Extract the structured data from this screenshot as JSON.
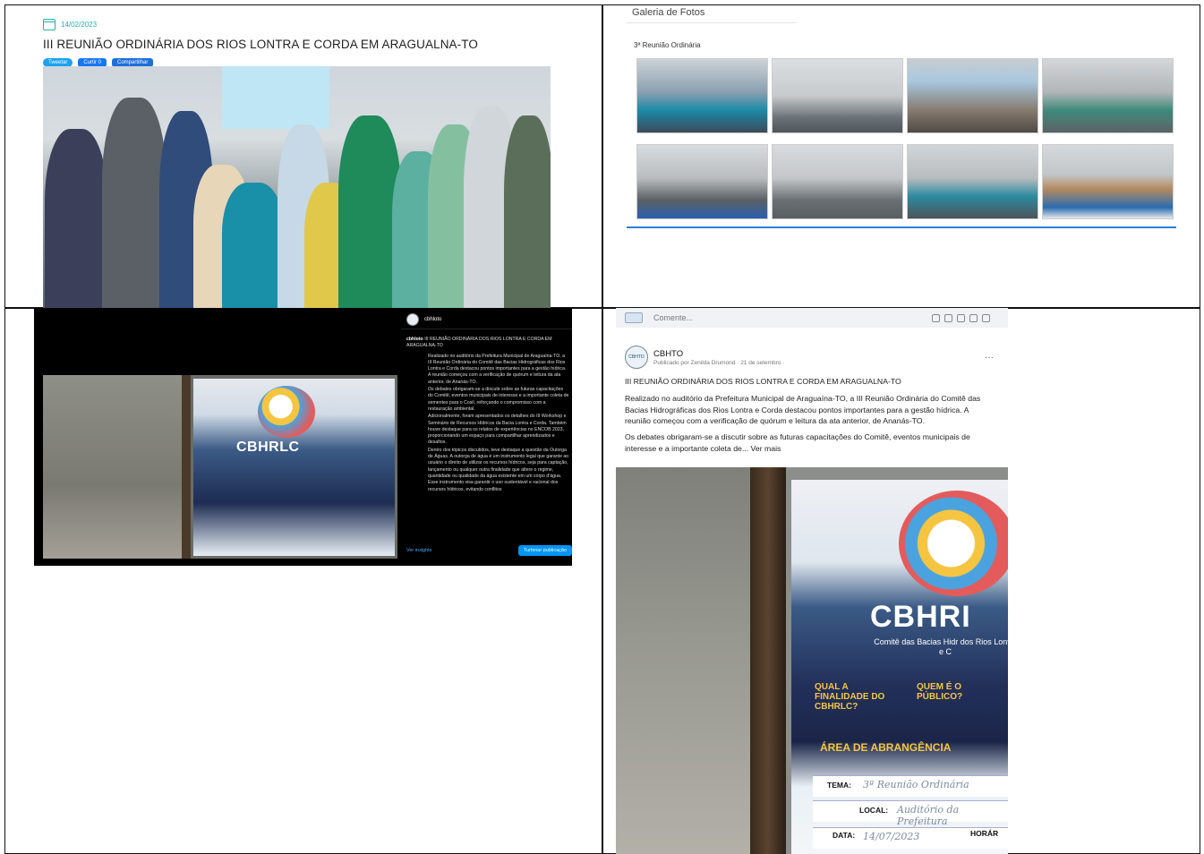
{
  "news_post": {
    "date": "14/02/2023",
    "title": "III REUNIÃO ORDINÁRIA DOS RIOS LONTRA E CORDA EM ARAGUALNA-TO",
    "share_buttons": [
      "Tweetar",
      "Curtir 0",
      "Compartilhar"
    ]
  },
  "gallery": {
    "title": "Galeria de Fotos",
    "subtitle": "3ª Reunião Ordinária",
    "thumbnail_count": 8
  },
  "instagram": {
    "account": "cbhloto",
    "caption_user": "cbhloto",
    "caption_title": "III REUNIÃO ORDINÁRIA DOS RIOS LONTRA E CORDA EM ARAGUALNA-TO",
    "caption_paragraphs": [
      "Realizado no auditório da Prefeitura Municipal de Araguaína-TO, a III Reunião Ordinária do Comitê das Bacias Hidrográficas dos Rios Lontra e Corda destacou pontos importantes para a gestão hídrica. A reunião começou com a verificação de quórum e leitura da ata anterior, de Ananás-TO.",
      "Os debates obrigaram-se a discutir sobre as futuras capacitações do Comitê, eventos municipais de interesse e a importante coleta de sementes para o Cosil, reforçando o compromisso com a restauração ambiental.",
      "Adicionalmente, foram apresentados os detalhes do III Workshop e Seminário de Recursos Hídricos da Bacia Lontra e Corda. Também houve destaque para os relatos de experiências no ENCOB 2023, proporcionando um espaço para compartilhar aprendizados e desafios.",
      "Dentro dos tópicos discutidos, teve destaque a questão da Outorga de Águas. A outorga de água é um instrumento legal que garante ao usuário o direito de utilizar os recursos hídricos, seja para captação, lançamento ou qualquer outra finalidade que altere o regime, quantidade ou qualidade da água existente em um corpo d'água. Esse instrumento visa garantir o uso sustentável e racional dos recursos hídricos, evitando conflitos"
    ],
    "poster_title": "CBHRLC",
    "insights_label": "Ver insights",
    "boost_label": "Turbinar publicação"
  },
  "facebook": {
    "comment_placeholder": "Comente...",
    "page_name": "CBHTO",
    "avatar_text": "CBHTO",
    "meta": "Publicado por Zenilda Drumond · 21 de setembro ·",
    "post_title": "III REUNIÃO ORDINÁRIA DOS RIOS LONTRA E CORDA EM ARAGUALNA-TO",
    "paragraph_1": "Realizado no auditório da Prefeitura Municipal de Araguaína-TO, a III Reunião Ordinária do Comitê das Bacias Hidrográficas dos Rios Lontra e Corda destacou pontos importantes para a gestão hídrica. A reunião começou com a verificação de quórum e leitura da ata anterior, de Ananás-TO.",
    "paragraph_2": "Os debates obrigaram-se a discutir sobre as futuras capacitações do Comitê, eventos municipais de interesse e a importante coleta de...",
    "see_more": "Ver mais",
    "poster": {
      "title": "CBHRI",
      "subtitle": "Comitê das Bacias Hidr dos Rios Lontra e C",
      "q1": "QUAL A FINALIDADE DO CBHRLC?",
      "q2": "QUEM É O PÚBLICO?",
      "area": "ÁREA DE ABRANGÊNCIA",
      "tema_label": "TEMA:",
      "tema_value": "3ª Reunião Ordinária",
      "local_label": "LOCAL:",
      "local_value": "Auditório da Prefeitura",
      "data_label": "DATA:",
      "data_value": "14/07/2023",
      "horario_label": "HORÁR"
    }
  }
}
